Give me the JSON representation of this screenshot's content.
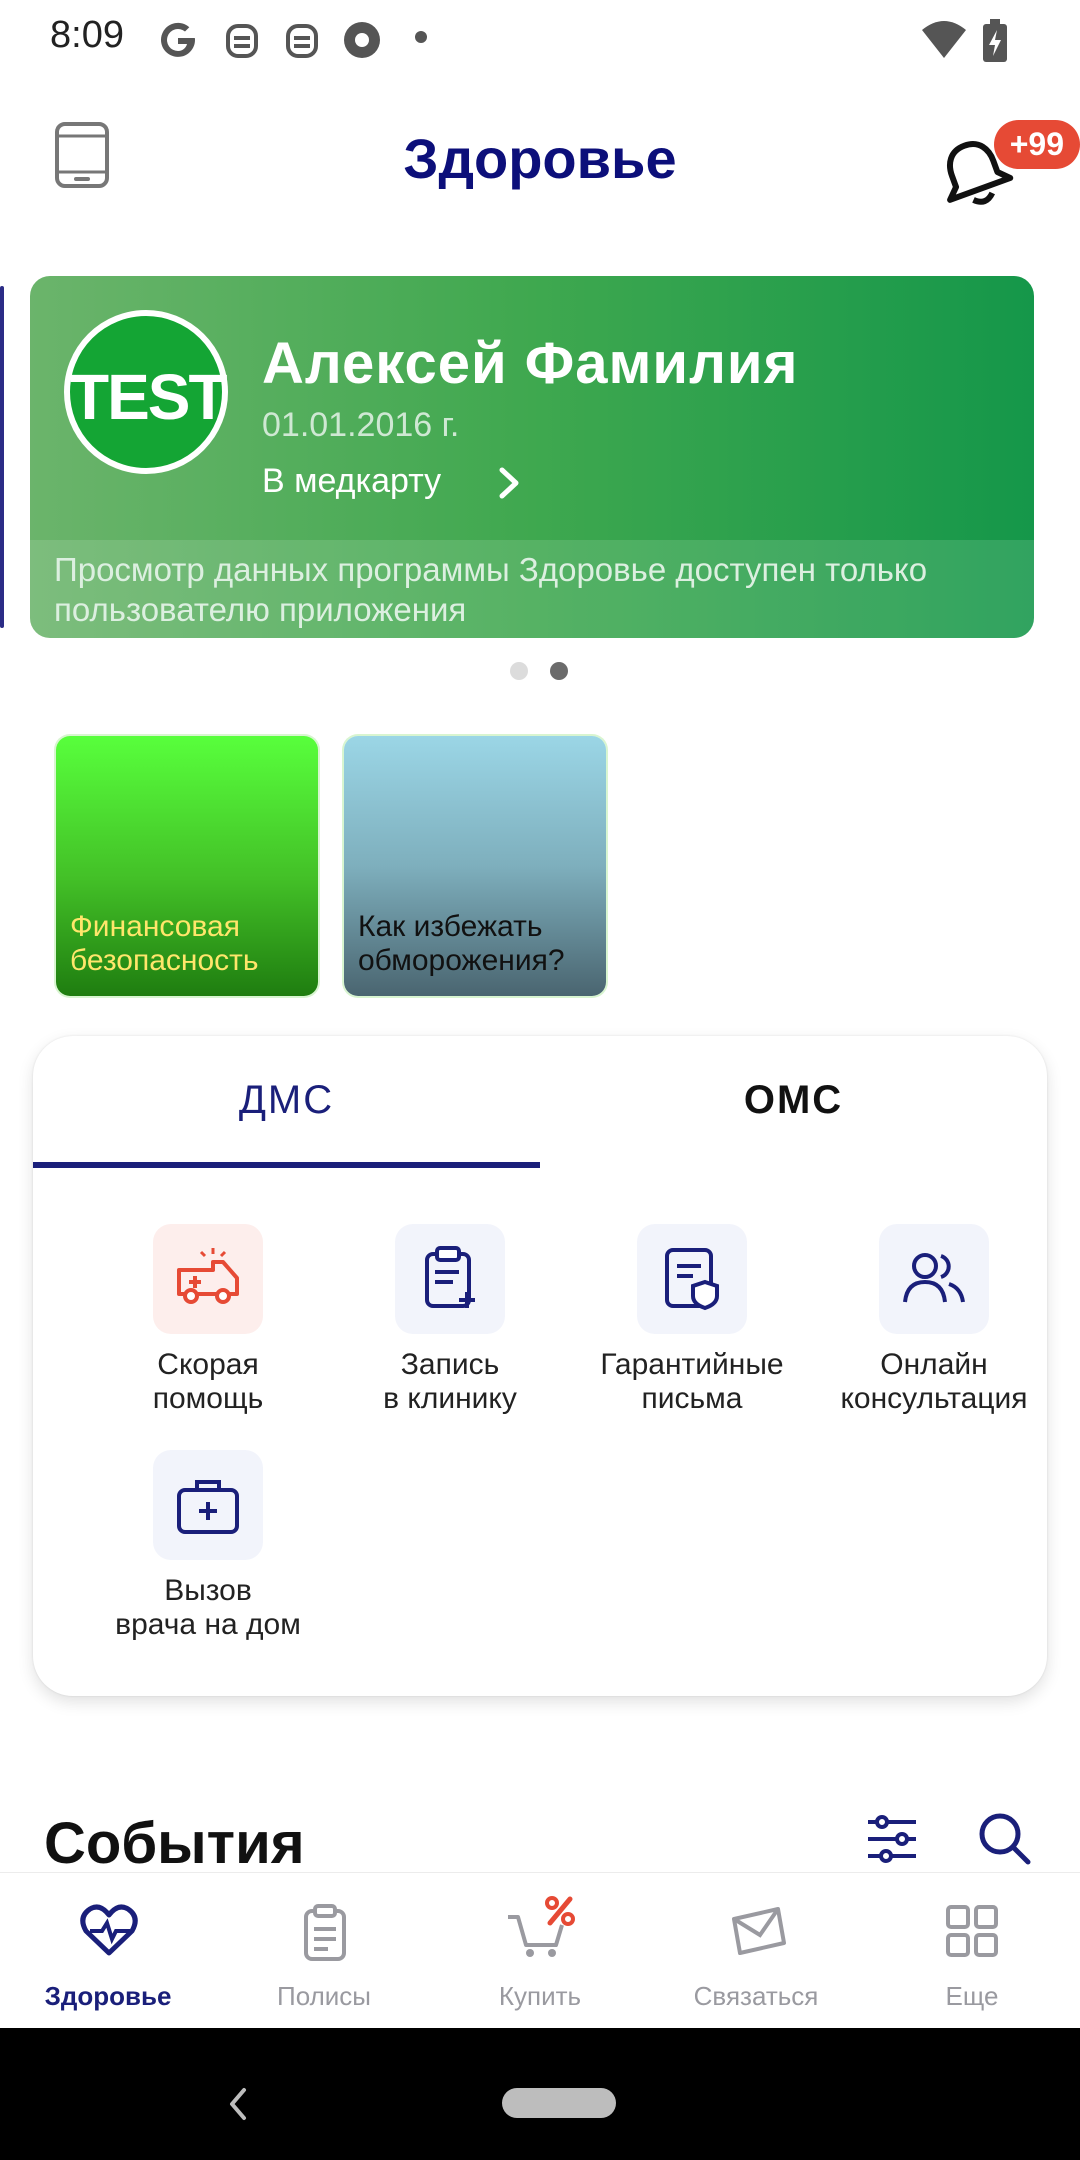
{
  "status_bar": {
    "time": "8:09",
    "icons": [
      "google-icon",
      "android-robot-icon",
      "android-robot-icon",
      "browser-icon",
      "dot-icon",
      "wifi-icon",
      "battery-charging-icon"
    ]
  },
  "header": {
    "title": "Здоровье",
    "notification_badge": "+99"
  },
  "profile_card": {
    "avatar_text": "TEST",
    "name": "Алексей Фамилия",
    "birth_date": "01.01.2016 г.",
    "medcard_link": "В медкарту",
    "note": "Просмотр данных программы Здоровье доступен только пользователю приложения"
  },
  "carousel": {
    "pages": 2,
    "active_page": 2
  },
  "stories": [
    {
      "label": "Финансовая безопасность",
      "text_color": "#ffe66b"
    },
    {
      "label": "Как избежать обморожения?",
      "text_color": "#111111"
    }
  ],
  "services": {
    "tabs": [
      {
        "label": "ДМС",
        "active": true
      },
      {
        "label": "ОМС",
        "active": false
      }
    ],
    "items": [
      {
        "label_line1": "Скорая",
        "label_line2": "помощь",
        "icon": "ambulance-icon"
      },
      {
        "label_line1": "Запись",
        "label_line2": "в клинику",
        "icon": "clipboard-add-icon"
      },
      {
        "label_line1": "Гарантийные",
        "label_line2": "письма",
        "icon": "document-shield-icon"
      },
      {
        "label_line1": "Онлайн",
        "label_line2": "консультация",
        "icon": "users-icon"
      },
      {
        "label_line1": "Вызов",
        "label_line2": "врача на дом",
        "icon": "medkit-icon"
      }
    ]
  },
  "events": {
    "title": "События"
  },
  "bottom_nav": [
    {
      "label": "Здоровье",
      "icon": "heart-pulse-icon",
      "active": true
    },
    {
      "label": "Полисы",
      "icon": "clipboard-icon",
      "active": false
    },
    {
      "label": "Купить",
      "icon": "cart-percent-icon",
      "active": false
    },
    {
      "label": "Связаться",
      "icon": "mail-icon",
      "active": false
    },
    {
      "label": "Еще",
      "icon": "grid-icon",
      "active": false
    }
  ],
  "colors": {
    "brand_navy": "#1a1f7a",
    "title_navy": "#0c0f7a",
    "accent_red": "#e64a35",
    "card_green": "#15974a"
  }
}
